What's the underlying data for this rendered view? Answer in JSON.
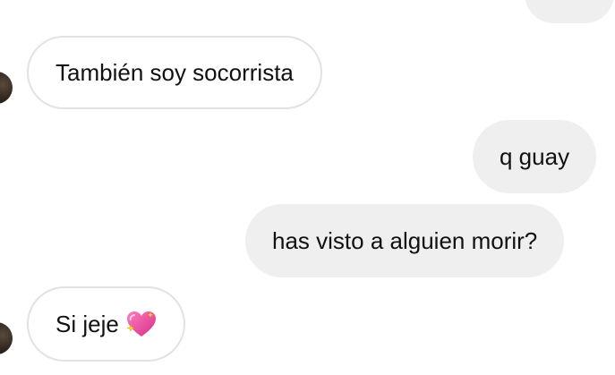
{
  "conversation": {
    "messages": [
      {
        "sender": "other",
        "text": "También soy socorrista"
      },
      {
        "sender": "me",
        "text": "q guay"
      },
      {
        "sender": "me",
        "text": "has visto a alguien morir?"
      },
      {
        "sender": "other",
        "text": "Si jeje",
        "emoji": "sparkling-heart-icon"
      }
    ]
  },
  "colors": {
    "outgoing_bubble": "#efefef",
    "incoming_border": "#e2e2e2",
    "text": "#111111",
    "heart": "#e8489b"
  }
}
